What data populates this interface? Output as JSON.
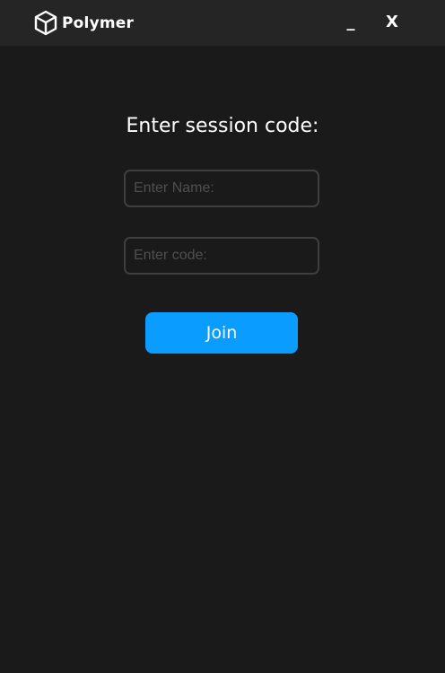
{
  "app": {
    "brand_name": "Polymer",
    "logo_icon": "cube-icon"
  },
  "window_controls": {
    "minimize_label": "_",
    "close_label": "X"
  },
  "join_form": {
    "heading": "Enter session code:",
    "name_placeholder": "Enter Name:",
    "name_value": "",
    "code_placeholder": "Enter code:",
    "code_value": "",
    "join_label": "Join"
  },
  "colors": {
    "background": "#1a1a1a",
    "titlebar": "#252525",
    "accent": "#0a9cff",
    "field_border": "#3f3f3f",
    "placeholder": "#4f4f4f"
  }
}
